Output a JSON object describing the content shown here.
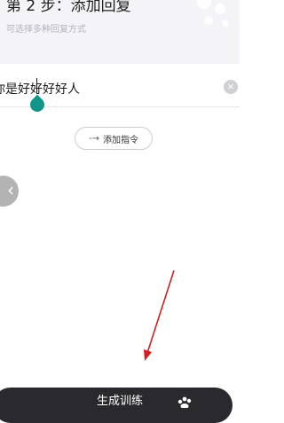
{
  "header": {
    "step_title": "第 2 步：添加回复",
    "step_subtitle": "可选择多种回复方式"
  },
  "reply": {
    "text": "你是好好好好人",
    "clear_icon": "×"
  },
  "add_command": {
    "icon": "-→",
    "label": "添加指令"
  },
  "back_button": {
    "icon": "‹"
  },
  "generate_button": {
    "label": "生成训练"
  },
  "colors": {
    "header_bg": "#f4f3f8",
    "caret_handle": "#12968a",
    "annotation_arrow": "#d41f1f",
    "generate_bg": "#2a2a2e"
  }
}
